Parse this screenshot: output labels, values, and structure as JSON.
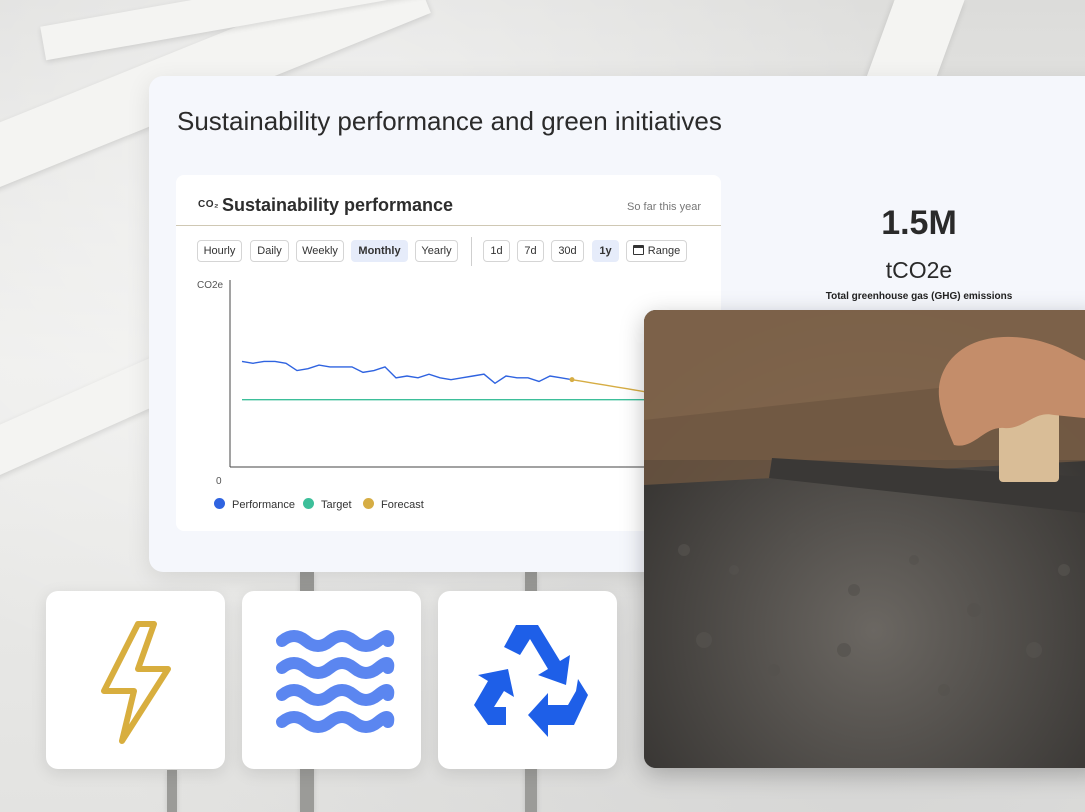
{
  "page": {
    "title": "Sustainability performance and green initiatives"
  },
  "chart_panel": {
    "icon_label": "CO₂",
    "title": "Sustainability performance",
    "subtitle": "So far this year",
    "granularity_buttons": [
      {
        "label": "Hourly",
        "active": false
      },
      {
        "label": "Daily",
        "active": false
      },
      {
        "label": "Weekly",
        "active": false
      },
      {
        "label": "Monthly",
        "active": true
      },
      {
        "label": "Yearly",
        "active": false
      }
    ],
    "range_buttons": [
      {
        "label": "1d",
        "active": false
      },
      {
        "label": "7d",
        "active": false
      },
      {
        "label": "30d",
        "active": false
      },
      {
        "label": "1y",
        "active": true
      }
    ],
    "range_picker_label": "Range"
  },
  "chart_data": {
    "type": "line",
    "ylabel": "CO2e",
    "ytick_min_label": "0",
    "ylim": [
      0,
      100
    ],
    "series": [
      {
        "name": "Performance",
        "color": "#2f63e0",
        "values": [
          58,
          57,
          58,
          58,
          57,
          53,
          54,
          56,
          55,
          55,
          55,
          52,
          53,
          55,
          49,
          50,
          49,
          51,
          49,
          48,
          49,
          50,
          51,
          46,
          50,
          49,
          49,
          47,
          50,
          49,
          48
        ]
      },
      {
        "name": "Target",
        "color": "#3dbf9a",
        "values": [
          37,
          37,
          37,
          37,
          37,
          37,
          37,
          37,
          37,
          37,
          37,
          37,
          37,
          37,
          37,
          37,
          37,
          37,
          37,
          37,
          37,
          37,
          37,
          37,
          37,
          37,
          37,
          37,
          37,
          37,
          37,
          37,
          37,
          37,
          37,
          37,
          37,
          37,
          37,
          37,
          37,
          37
        ]
      },
      {
        "name": "Forecast",
        "color": "#d6ad44",
        "start_index": 30,
        "values": [
          48,
          47,
          46,
          45,
          44,
          43,
          42,
          41
        ]
      }
    ],
    "legend_position": "bottom-left"
  },
  "kpi": {
    "value": "1.5M",
    "unit": "tCO2e",
    "caption": "Total greenhouse gas (GHG) emissions"
  },
  "tiles": [
    {
      "icon": "lightning-bolt-icon",
      "color": "#d8ae3e"
    },
    {
      "icon": "water-waves-icon",
      "color": "#5b86f0"
    },
    {
      "icon": "recycle-icon",
      "color": "#1e5fe8"
    }
  ],
  "photo": {
    "subject": "concrete-troweling-photo"
  }
}
